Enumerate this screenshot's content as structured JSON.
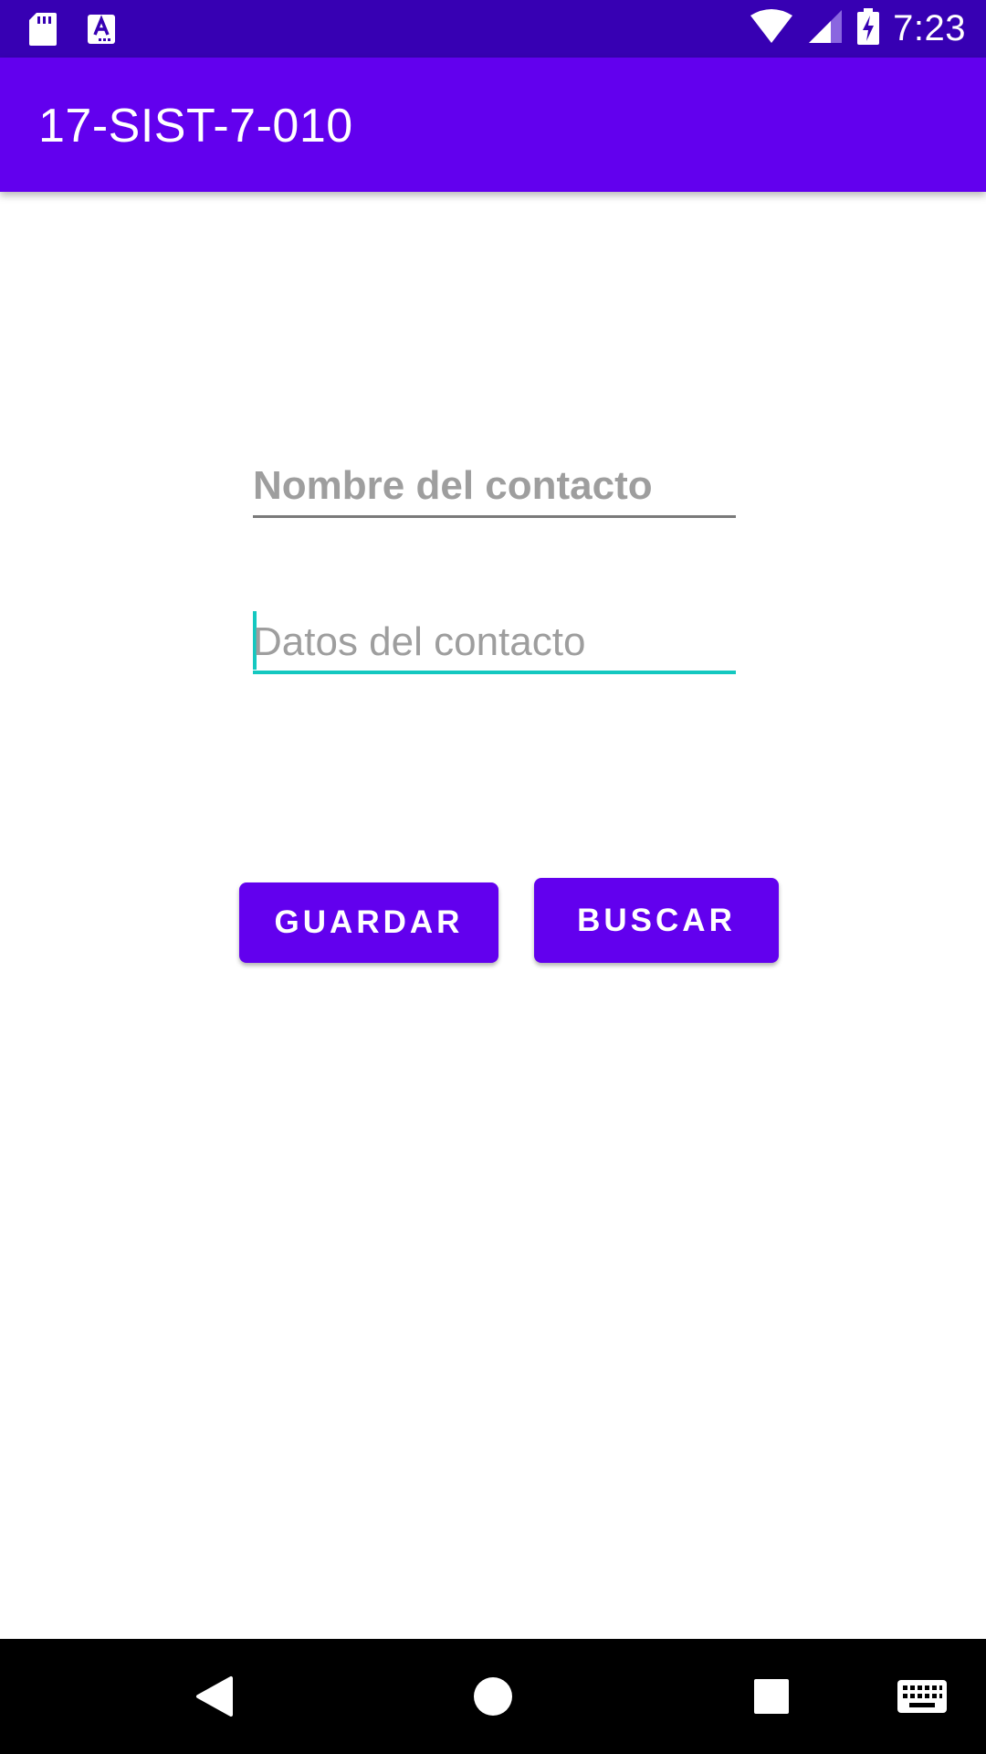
{
  "status_bar": {
    "time": "7:23",
    "icons": [
      "sd-card-icon",
      "keyboard-ime-icon",
      "wifi-icon",
      "cell-signal-icon",
      "battery-charging-icon"
    ]
  },
  "app_bar": {
    "title": "17-SIST-7-010"
  },
  "form": {
    "name_field": {
      "placeholder": "Nombre del contacto",
      "value": ""
    },
    "data_field": {
      "placeholder": "Datos del contacto",
      "value": ""
    }
  },
  "buttons": {
    "save_label": "GUARDAR",
    "search_label": "BUSCAR"
  },
  "nav_bar": {
    "icons": [
      "back-icon",
      "home-icon",
      "recents-icon",
      "keyboard-icon"
    ]
  },
  "colors": {
    "status_bar": "#3700b3",
    "primary": "#6200ee",
    "accent": "#14c8c0",
    "hint_text": "#9e9e9e"
  }
}
